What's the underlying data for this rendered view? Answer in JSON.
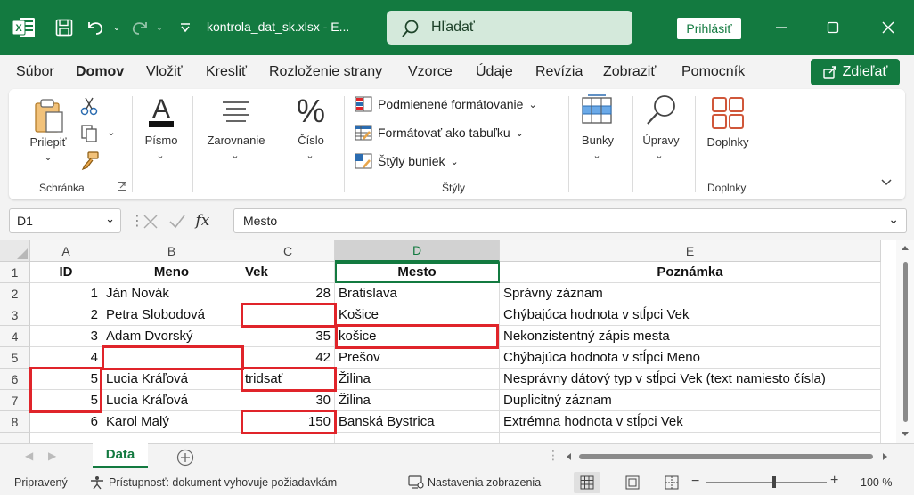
{
  "titlebar": {
    "filename": "kontrola_dat_sk.xlsx  -  E...",
    "search_placeholder": "Hľadať",
    "signin_label": "Prihlásiť"
  },
  "menu": {
    "tabs": [
      "Súbor",
      "Domov",
      "Vložiť",
      "Kresliť",
      "Rozloženie strany",
      "Vzorce",
      "Údaje",
      "Revízia",
      "Zobraziť",
      "Pomocník"
    ],
    "active": "Domov",
    "share_label": "Zdieľať"
  },
  "ribbon": {
    "paste_label": "Prilepiť",
    "clipboard_group": "Schránka",
    "font_label": "Písmo",
    "alignment_label": "Zarovnanie",
    "number_label": "Číslo",
    "conditional_formatting": "Podmienené formátovanie",
    "format_as_table": "Formátovať ako tabuľku",
    "cell_styles": "Štýly buniek",
    "styles_group": "Štýly",
    "cells_label": "Bunky",
    "editing_label": "Úpravy",
    "addins_label": "Doplnky",
    "addins_group": "Doplnky"
  },
  "formula_bar": {
    "name_box": "D1",
    "fx": "fx",
    "content": "Mesto"
  },
  "sheet": {
    "columns": [
      "A",
      "B",
      "C",
      "D",
      "E"
    ],
    "selected_column": "D",
    "header_row": [
      "ID",
      "Meno",
      "Vek",
      "Mesto",
      "Poznámka"
    ],
    "rows": [
      {
        "n": "2",
        "id": "1",
        "meno": "Ján Novák",
        "vek": "28",
        "mesto": "Bratislava",
        "poznamka": "Správny záznam"
      },
      {
        "n": "3",
        "id": "2",
        "meno": "Petra Slobodová",
        "vek": "",
        "mesto": "Košice",
        "poznamka": "Chýbajúca hodnota v stĺpci Vek"
      },
      {
        "n": "4",
        "id": "3",
        "meno": "Adam Dvorský",
        "vek": "35",
        "mesto": "košice",
        "poznamka": "Nekonzistentný zápis mesta"
      },
      {
        "n": "5",
        "id": "4",
        "meno": "",
        "vek": "42",
        "mesto": "Prešov",
        "poznamka": "Chýbajúca hodnota v stĺpci Meno"
      },
      {
        "n": "6",
        "id": "5",
        "meno": "Lucia Kráľová",
        "vek": "tridsať",
        "mesto": "Žilina",
        "poznamka": "Nesprávny dátový typ v stĺpci Vek (text namiesto čísla)"
      },
      {
        "n": "7",
        "id": "5",
        "meno": "Lucia Kráľová",
        "vek": "30",
        "mesto": "Žilina",
        "poznamka": "Duplicitný záznam"
      },
      {
        "n": "8",
        "id": "6",
        "meno": "Karol Malý",
        "vek": "150",
        "mesto": "Banská Bystrica",
        "poznamka": "Extrémna hodnota v stĺpci Vek"
      }
    ],
    "header_row_number": "1",
    "sheet_tab": "Data"
  },
  "statusbar": {
    "ready": "Pripravený",
    "accessibility": "Prístupnosť: dokument vyhovuje požiadavkám",
    "view_settings": "Nastavenia zobrazenia",
    "zoom": "100 %"
  },
  "colors": {
    "accent": "#137a40",
    "highlight": "#e0242a"
  }
}
